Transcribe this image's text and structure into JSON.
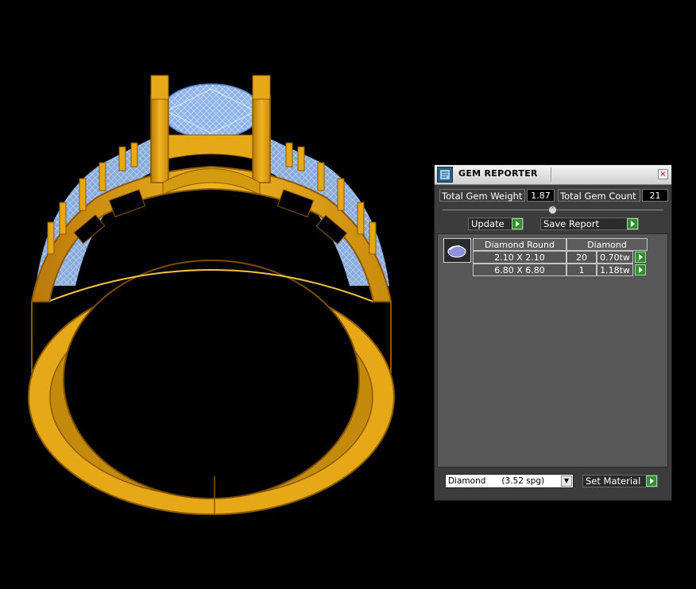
{
  "panel": {
    "title": "GEM REPORTER",
    "close_glyph": "×",
    "total_gem_weight": {
      "label": "Total Gem Weight",
      "value": "1.87"
    },
    "total_gem_count": {
      "label": "Total Gem Count",
      "value": "21"
    },
    "update_label": "Update",
    "save_report_label": "Save Report",
    "report": {
      "columns": [
        "Diamond Round",
        "Diamond"
      ],
      "rows": [
        {
          "size": "2.10 X 2.10",
          "count": "20",
          "weight": "0.70tw"
        },
        {
          "size": "6.80 X 6.80",
          "count": "1",
          "weight": "1.18tw"
        }
      ]
    },
    "material_select": {
      "value": "Diamond      (3.52 spg)"
    },
    "set_material_label": "Set Material"
  },
  "icons": {
    "app": "gem-reporter-app-icon",
    "close": "close-icon",
    "go": "green-play-arrow-icon",
    "gem": "diamond-gem-icon",
    "dropdown": "chevron-down-icon"
  },
  "colors": {
    "gold": "#E6A817",
    "gold_dark": "#8A5A00",
    "gem_blue": "#8FB4E8",
    "panel_bg": "#3C3C3C",
    "go_button": "#2F8F2F"
  }
}
